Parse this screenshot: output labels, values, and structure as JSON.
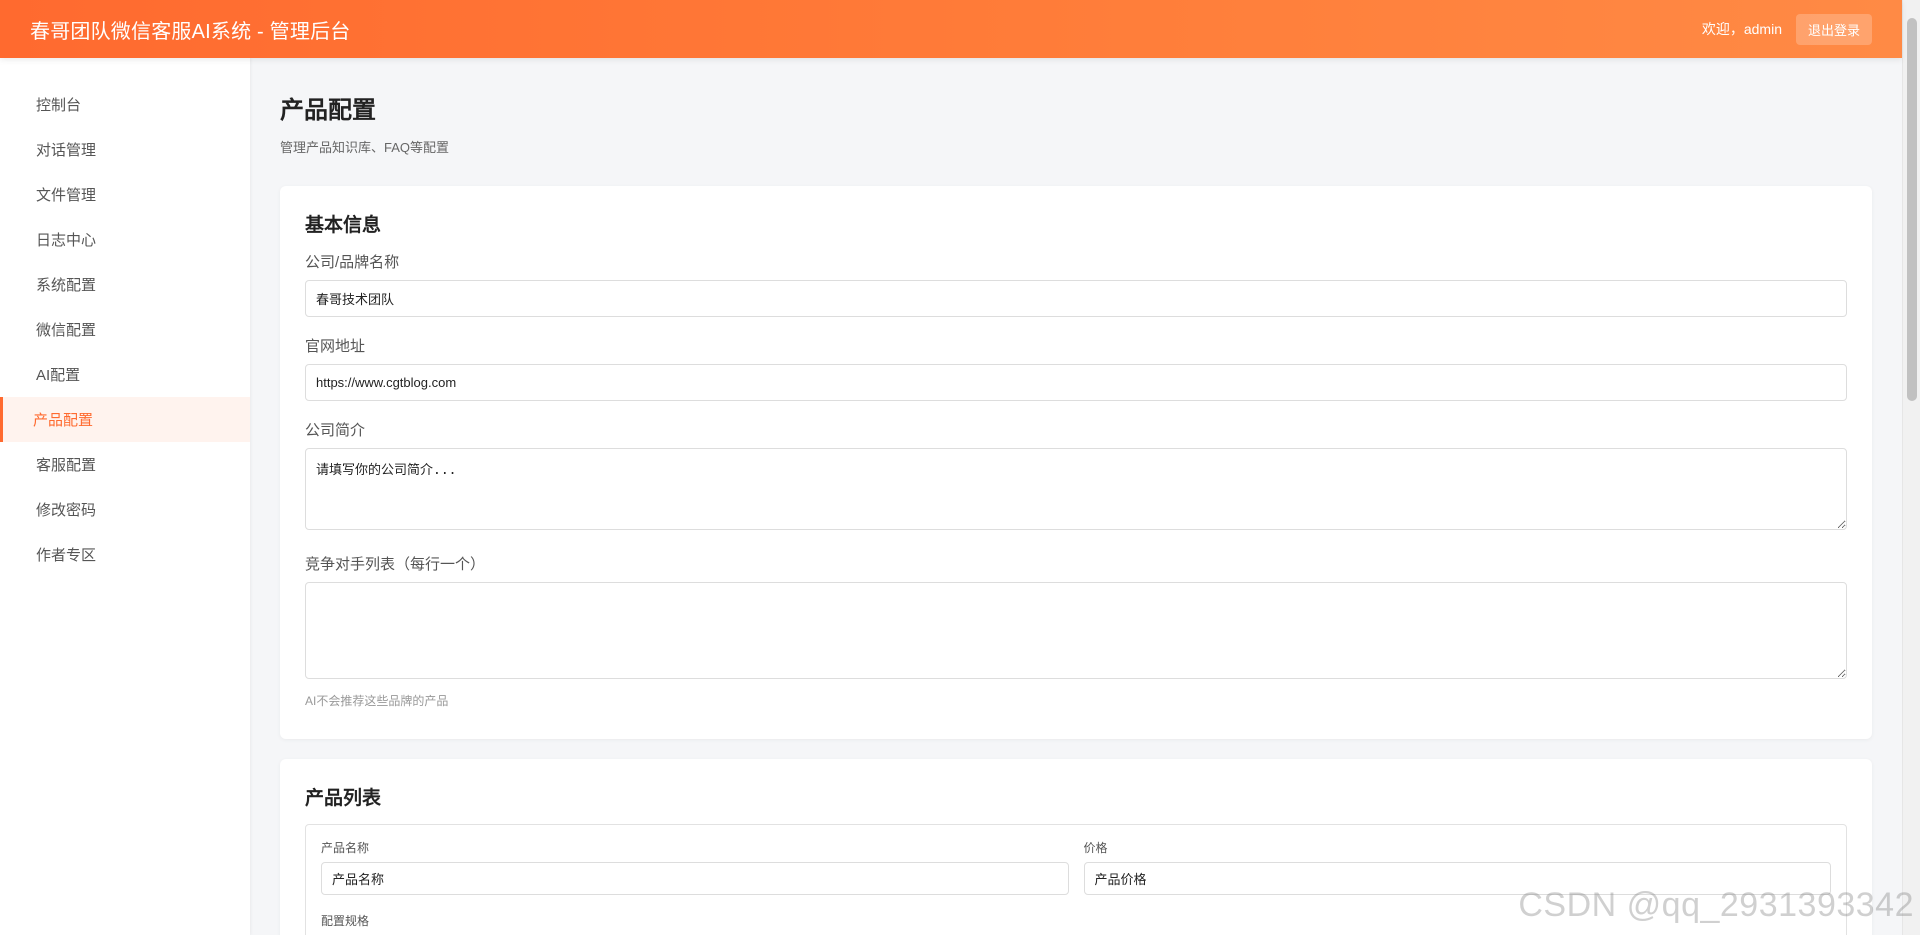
{
  "header": {
    "title": "春哥团队微信客服AI系统 - 管理后台",
    "welcome": "欢迎，admin",
    "logout_label": "退出登录"
  },
  "sidebar": {
    "items": [
      {
        "label": "控制台"
      },
      {
        "label": "对话管理"
      },
      {
        "label": "文件管理"
      },
      {
        "label": "日志中心"
      },
      {
        "label": "系统配置"
      },
      {
        "label": "微信配置"
      },
      {
        "label": "AI配置"
      },
      {
        "label": "产品配置"
      },
      {
        "label": "客服配置"
      },
      {
        "label": "修改密码"
      },
      {
        "label": "作者专区"
      }
    ],
    "active_index": 7
  },
  "page": {
    "title": "产品配置",
    "subtitle": "管理产品知识库、FAQ等配置"
  },
  "basic_info": {
    "title": "基本信息",
    "company_name": {
      "label": "公司/品牌名称",
      "value": "春哥技术团队"
    },
    "website": {
      "label": "官网地址",
      "value": "https://www.cgtblog.com"
    },
    "intro": {
      "label": "公司简介",
      "value": "请填写你的公司简介..."
    },
    "competitors": {
      "label": "竞争对手列表（每行一个）",
      "value": "",
      "hint": "AI不会推荐这些品牌的产品"
    }
  },
  "product_list": {
    "title": "产品列表",
    "name_field": {
      "label": "产品名称",
      "value": "产品名称"
    },
    "price_field": {
      "label": "价格",
      "value": "产品价格"
    },
    "next_label": "配置规格"
  },
  "watermark": "CSDN @qq_2931393342",
  "colors": {
    "accent": "#ff6a2f",
    "header_gradient_end": "#ff8a45",
    "active_nav_bg": "#fff3ee"
  }
}
